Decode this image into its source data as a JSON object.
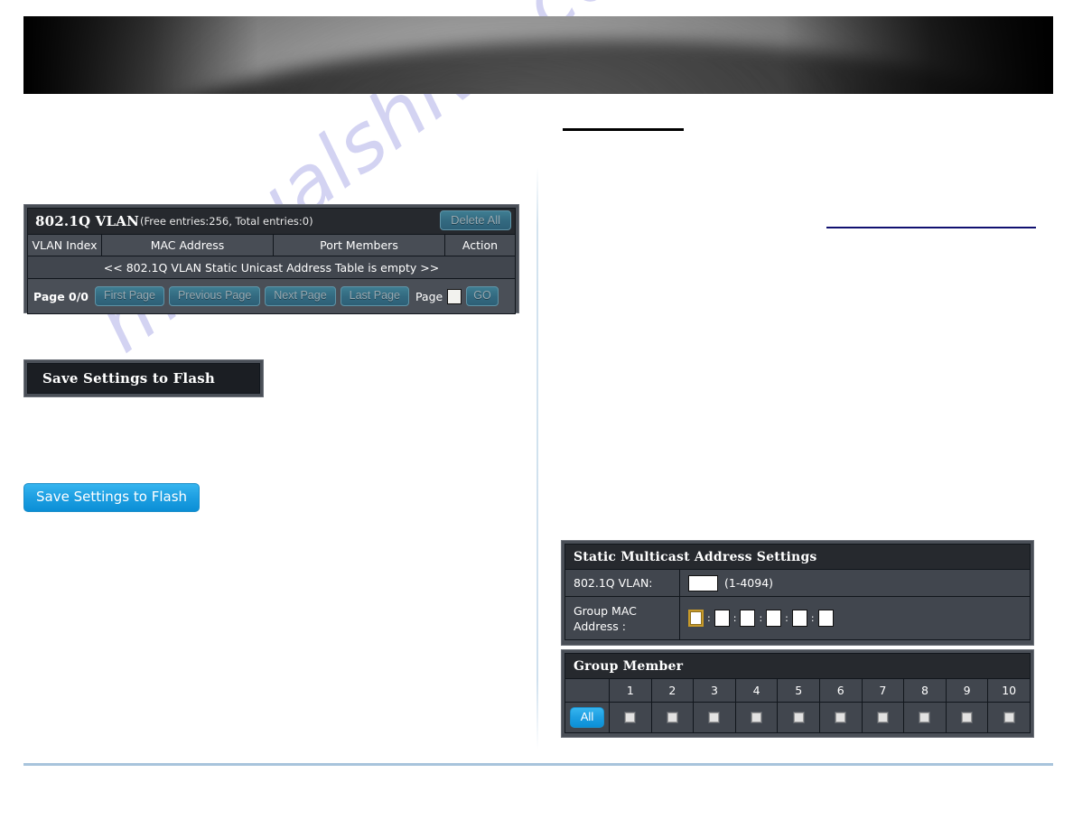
{
  "watermark": {
    "text": "manualshive.com"
  },
  "banner": {
    "name": "product-banner"
  },
  "vlan_table": {
    "title_strong": "802.1Q VLAN",
    "title_sub": "(Free entries:256, Total entries:0)",
    "delete_all_label": "Delete All",
    "columns": [
      "VLAN Index",
      "MAC Address",
      "Port Members",
      "Action"
    ],
    "empty_message": "<< 802.1Q VLAN Static Unicast Address Table is empty >>",
    "pager": {
      "page_status": "Page 0/0",
      "first_page": "First Page",
      "previous_page": "Previous Page",
      "next_page": "Next Page",
      "last_page": "Last Page",
      "page_label": "Page",
      "page_input_value": "",
      "go_label": "GO"
    }
  },
  "save_flash_dark": {
    "label": "Save Settings to Flash"
  },
  "save_flash_blue": {
    "label": "Save Settings to Flash"
  },
  "multicast": {
    "title": "Static Multicast Address Settings",
    "vlan_label": "802.1Q VLAN:",
    "vlan_value": "",
    "vlan_hint": "(1-4094)",
    "mac_label": "Group MAC Address :",
    "mac_octets": [
      "",
      "",
      "",
      "",
      "",
      ""
    ],
    "mac_separator": ":"
  },
  "group_member": {
    "title": "Group Member",
    "all_label": "All",
    "ports": [
      "1",
      "2",
      "3",
      "4",
      "5",
      "6",
      "7",
      "8",
      "9",
      "10"
    ],
    "checked": [
      false,
      false,
      false,
      false,
      false,
      false,
      false,
      false,
      false,
      false
    ]
  },
  "colors": {
    "panel_bg": "#4a4f57",
    "row_bg": "#41464e",
    "title_bg": "#26292e",
    "accent_blue": "#1e9fe2",
    "btn_teal": "#336a80",
    "focus_gold": "#c79a2a",
    "footer_rule": "#a8c4dc",
    "navy_rule": "#101070"
  }
}
